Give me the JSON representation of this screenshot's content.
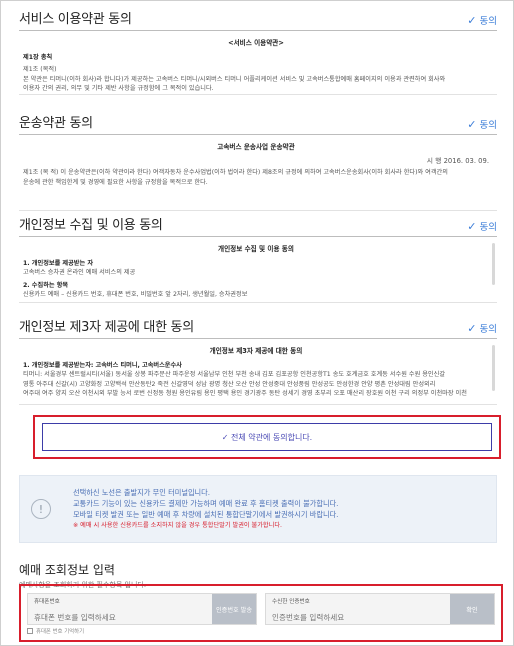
{
  "agree_label": "동의",
  "sections": [
    {
      "title": "서비스 이용약관 동의",
      "box_title": "<서비스 이용약관>",
      "lines": [
        {
          "text": "제1장 총칙",
          "bold": true
        },
        {
          "text": "제1조 (목적)",
          "bold": false
        },
        {
          "text": "본 약관은 티머니(이하 회사)라 합니다)가 제공하는 고속버스 티머니/시외버스 티머니 어플리케이션 서비스 및 고속버스통합예매 홈페이지의 이용과 관련하여 회사와",
          "bold": false
        },
        {
          "text": "이용자 간의 권리, 의무 및 기타 제반 사항을 규정함에 그 목적이 있습니다.",
          "bold": false
        }
      ]
    },
    {
      "title": "운송약관 동의",
      "box_title": "고속버스 운송사업 운송약관",
      "date": "시 행 2016. 03. 09.",
      "lines": [
        {
          "text": "제1조 (목 적) 이 운송약관은(이하 약관이라 한다) 여객자동차 운수사업법(이하 법이라 한다) 제8조의 규정에 의하여 고속버스운송회사(이하 회사라 한다)와 여객간의",
          "bold": false
        },
        {
          "text": "운송에 관한 책임한계 및 경영에 필요한 사항을 규정함을 목적으로 한다.",
          "bold": false
        }
      ]
    },
    {
      "title": "개인정보 수집 및 이용 동의",
      "box_title": "개인정보 수집 및 이용 동의",
      "lines": [
        {
          "text": "1. 개인정보를 제공받는 자",
          "bold": true
        },
        {
          "text": "고속버스 승차권 온라인 예매 서비스의 제공",
          "bold": false
        },
        {
          "text": "2. 수집하는 항목",
          "bold": true
        },
        {
          "text": "신용카드 예매 – 신용카드 번호, 휴대폰 번호, 비밀번호 앞 2자리, 생년월일, 승차권정보",
          "bold": false
        }
      ]
    },
    {
      "title": "개인정보 제3자 제공에 대한 동의",
      "box_title": "개인정보 제3자 제공에 대한 동의",
      "lines": [
        {
          "text": "1. 개인정보를 제공받는자: 고속버스 티머니, 고속버스운수사",
          "bold": true
        },
        {
          "text": "티머니: 서울경부 센트럴시티(서울) 동서울 상봉 파주문산 파주운정 서울남부 인천 부천 송내 김포 김포공항 인천공항T1 송도 호계금호 호계동 서수원 수원 용인신갈",
          "bold": false
        },
        {
          "text": "영통 아주대 신갈(시) 고양화정 고양백석 안산동탄2 죽전 신갈영덕 성남 광명 청산 오산 안성 안성중대 안성풍림 안성공도 안성한경 안양 평촌 안성대림 안성외리",
          "bold": false
        },
        {
          "text": "여주대 여주 양지 오산 이천시외 부발 능서 로번 신정동 청원 용인유림 용인 평택 용인 경기광주 동탄 성세기 경영 초부리 오포 매산리 장호원 이천 구리 의정부 이천마장 이천",
          "bold": false
        }
      ]
    }
  ],
  "all_agree": {
    "label": "✓ 전체 약관에 동의합니다."
  },
  "notice": {
    "icon": "info-icon",
    "lines": [
      "선택하신 노선은 출발지가 무인 터미널입니다.",
      "교통카드 기능이 있는 신용카드 결제만 가능하며 예매 완료 후 홈티켓 출력이 불가합니다.",
      "모바일 티켓 발권 또는 일반 예매 후 차량에 설치된 통합단말기에서 발권하시기 바랍니다."
    ],
    "warning": "※ 예매 시 사용한 신용카드를 소지하지 않을 경우 통합단말기 발권이 불가합니다."
  },
  "reservation": {
    "title": "예매 조회정보 입력",
    "subtitle": "예매사항을 조회하기 위한 필수항목 입니다.",
    "phone_label": "휴대폰번호",
    "phone_placeholder": "휴대폰 번호를 입력하세요",
    "send_button": "인증번호 발송",
    "code_label": "수신한 인증번호",
    "code_placeholder": "인증번호를 입력하세요",
    "confirm_button": "확인",
    "remember_label": "휴대폰 번호 기억하기"
  },
  "colors": {
    "accent": "#3b7dd8",
    "highlight": "#d81e2c",
    "notice_bg": "#edf2f8"
  }
}
